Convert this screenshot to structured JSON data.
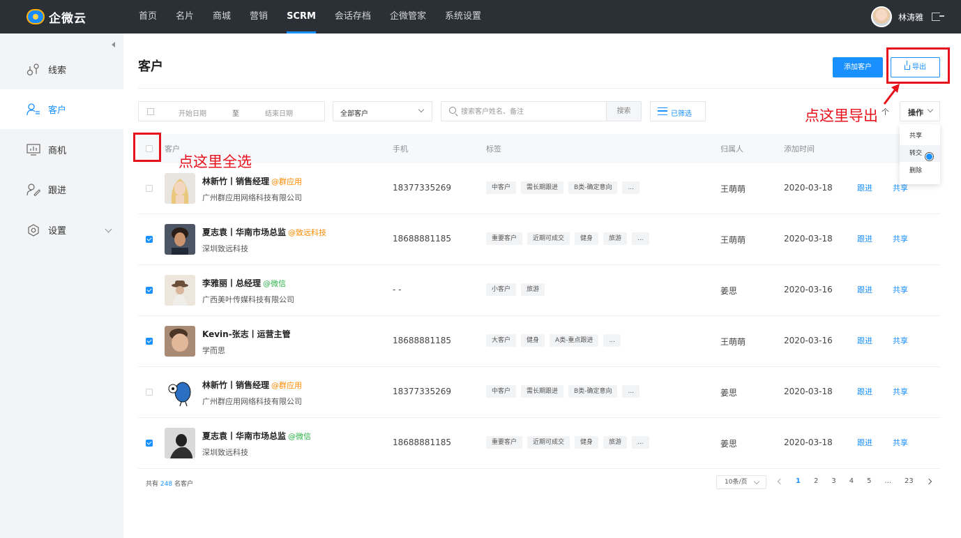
{
  "app": {
    "name": "企微云"
  },
  "nav": [
    {
      "label": "首页"
    },
    {
      "label": "名片"
    },
    {
      "label": "商城"
    },
    {
      "label": "营销"
    },
    {
      "label": "SCRM",
      "active": true
    },
    {
      "label": "会话存档"
    },
    {
      "label": "企微管家"
    },
    {
      "label": "系统设置"
    }
  ],
  "user": {
    "name": "林涛雅"
  },
  "sidebar": {
    "items": [
      {
        "label": "线索",
        "icon": "leads-icon"
      },
      {
        "label": "客户",
        "icon": "customer-icon",
        "active": true
      },
      {
        "label": "商机",
        "icon": "opportunity-icon"
      },
      {
        "label": "跟进",
        "icon": "follow-up-icon"
      },
      {
        "label": "设置",
        "icon": "settings-icon"
      }
    ]
  },
  "page": {
    "title": "客户",
    "add_label": "添加客户",
    "export_label": "导出"
  },
  "filters": {
    "start_placeholder": "开始日期",
    "to_label": "至",
    "end_placeholder": "结束日期",
    "scope": "全部客户",
    "search_placeholder": "搜索客户姓名、备注",
    "search_label": "搜索",
    "filtered_label": "已筛选",
    "ops_label": "操作",
    "partial_text": "个"
  },
  "table": {
    "headers": {
      "customer": "客户",
      "phone": "手机",
      "tags": "标签",
      "owner": "归属人",
      "added": "添加时间"
    },
    "rows": [
      {
        "checked": false,
        "name": "林新竹丨销售经理",
        "tag": "@群应用",
        "tag_color": "orange",
        "company": "广州群应用网络科技有限公司",
        "phone": "18377335269",
        "tags": [
          "中客户",
          "需长期跟进",
          "B类-确定意向",
          "..."
        ],
        "owner": "王萌萌",
        "date": "2020-03-18",
        "follow": "跟进",
        "share": "共享",
        "avatar": "woman-blonde"
      },
      {
        "checked": true,
        "name": "夏志袁丨华南市场总监",
        "tag": "@致远科技",
        "tag_color": "orange",
        "company": "深圳致远科技",
        "phone": "18688881185",
        "tags": [
          "重要客户",
          "近期可成交",
          "健身",
          "旅游",
          "..."
        ],
        "owner": "王萌萌",
        "date": "2020-03-18",
        "follow": "跟进",
        "share": "共享",
        "avatar": "man-curly"
      },
      {
        "checked": true,
        "name": "李雅丽丨总经理",
        "tag": "@微信",
        "tag_color": "green",
        "company": "广西美叶传媒科技有限公司",
        "phone": "- -",
        "tags": [
          "小客户",
          "旅游"
        ],
        "owner": "姜思",
        "date": "2020-03-16",
        "follow": "跟进",
        "share": "共享",
        "avatar": "woman-hat"
      },
      {
        "checked": true,
        "name": "Kevin-张志丨运营主管",
        "tag": "",
        "tag_color": "orange",
        "company": "学而思",
        "phone": "18688881185",
        "tags": [
          "大客户",
          "健身",
          "A类-重点跟进",
          "..."
        ],
        "owner": "王萌萌",
        "date": "2020-03-16",
        "follow": "跟进",
        "share": "共享",
        "avatar": "man-young"
      },
      {
        "checked": false,
        "name": "林新竹丨销售经理",
        "tag": "@群应用",
        "tag_color": "orange",
        "company": "广州群应用网络科技有限公司",
        "phone": "18377335269",
        "tags": [
          "中客户",
          "需长期跟进",
          "B类-确定意向",
          "..."
        ],
        "owner": "姜思",
        "date": "2020-03-18",
        "follow": "跟进",
        "share": "共享",
        "avatar": "bird-cartoon"
      },
      {
        "checked": true,
        "name": "夏志袁丨华南市场总监",
        "tag": "@微信",
        "tag_color": "green",
        "company": "深圳致远科技",
        "phone": "18688881185",
        "tags": [
          "重要客户",
          "近期可成交",
          "健身",
          "旅游",
          "..."
        ],
        "owner": "姜思",
        "date": "2020-03-18",
        "follow": "跟进",
        "share": "共享",
        "avatar": "man-dark"
      }
    ]
  },
  "footer": {
    "prefix": "共有",
    "total": "248",
    "suffix": "名客户",
    "page_size": "10条/页",
    "pages": [
      "1",
      "2",
      "3",
      "4",
      "5",
      "...",
      "23"
    ],
    "current_page": "1"
  },
  "menu": {
    "items": [
      "共享",
      "转交",
      "删除"
    ]
  },
  "annotations": {
    "select_all": "点这里全选",
    "export": "点这里导出"
  },
  "colors": {
    "nav_bg": "#2b2f36",
    "primary": "#1890ff",
    "annotation": "#e8101a"
  }
}
